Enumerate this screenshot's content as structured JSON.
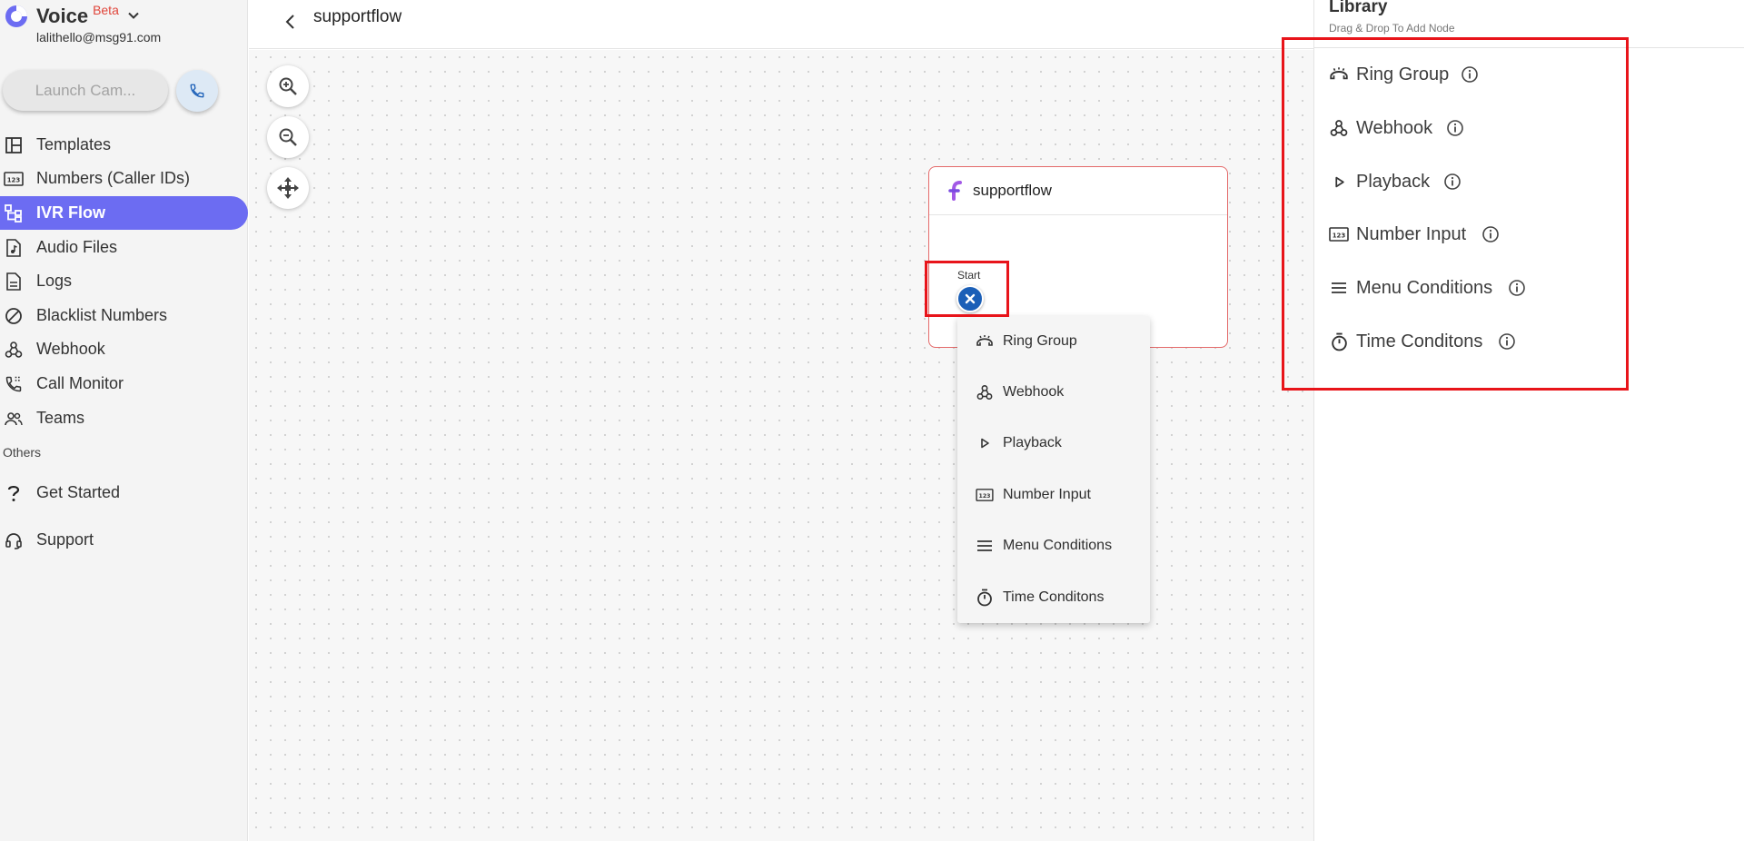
{
  "app": {
    "name": "Voice",
    "badge": "Beta",
    "account_email": "lalithello@msg91.com"
  },
  "sidebar": {
    "launch_button_label": "Launch Cam...",
    "items": [
      {
        "label": "Templates",
        "icon": "layout-icon"
      },
      {
        "label": "Numbers (Caller IDs)",
        "icon": "number-input-icon"
      },
      {
        "label": "IVR Flow",
        "icon": "flow-tree-icon",
        "active": true
      },
      {
        "label": "Audio Files",
        "icon": "audio-file-icon"
      },
      {
        "label": "Logs",
        "icon": "document-icon"
      },
      {
        "label": "Blacklist Numbers",
        "icon": "block-icon"
      },
      {
        "label": "Webhook",
        "icon": "webhook-icon"
      },
      {
        "label": "Call Monitor",
        "icon": "call-monitor-icon"
      },
      {
        "label": "Teams",
        "icon": "people-icon"
      }
    ],
    "others_label": "Others",
    "other_items": [
      {
        "label": "Get Started",
        "icon": "question-icon"
      },
      {
        "label": "Support",
        "icon": "headset-icon"
      }
    ]
  },
  "header": {
    "flow_title": "supportflow"
  },
  "canvas": {
    "node": {
      "title": "supportflow"
    },
    "start_label": "Start",
    "node_menu": [
      {
        "label": "Ring Group",
        "icon": "ring-group-icon"
      },
      {
        "label": "Webhook",
        "icon": "webhook-icon"
      },
      {
        "label": "Playback",
        "icon": "play-icon"
      },
      {
        "label": "Number Input",
        "icon": "number-input-icon"
      },
      {
        "label": "Menu Conditions",
        "icon": "menu-icon"
      },
      {
        "label": "Time Conditons",
        "icon": "timer-icon"
      }
    ]
  },
  "library": {
    "title": "Library",
    "subtitle": "Drag & Drop To Add Node",
    "items": [
      {
        "label": "Ring Group",
        "icon": "ring-group-icon"
      },
      {
        "label": "Webhook",
        "icon": "webhook-icon"
      },
      {
        "label": "Playback",
        "icon": "play-icon"
      },
      {
        "label": "Number Input",
        "icon": "number-input-icon"
      },
      {
        "label": "Menu Conditions",
        "icon": "menu-icon"
      },
      {
        "label": "Time Conditons",
        "icon": "timer-icon"
      }
    ]
  },
  "colors": {
    "accent": "#6c6cf2",
    "handle": "#1b5fb7",
    "highlight": "#e8141a",
    "beta": "#e0453a",
    "node_border": "#e46a6a"
  }
}
